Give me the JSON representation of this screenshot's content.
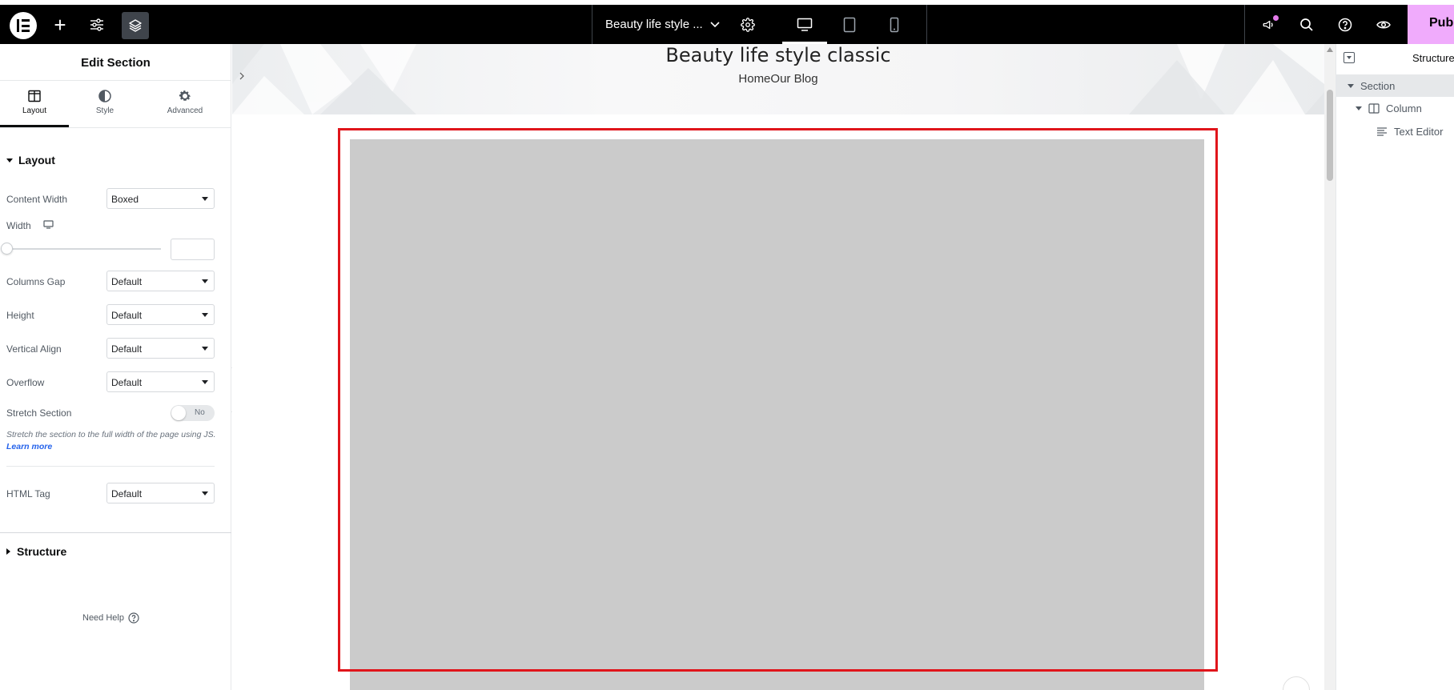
{
  "toolbar": {
    "document_title": "Beauty life style ...",
    "publish_label": "Publ"
  },
  "panel": {
    "title": "Edit Section",
    "tabs": [
      {
        "label": "Layout",
        "icon": "columns-icon"
      },
      {
        "label": "Style",
        "icon": "contrast-icon"
      },
      {
        "label": "Advanced",
        "icon": "gear-icon"
      }
    ],
    "layout_section": "Layout",
    "controls": {
      "content_width": {
        "label": "Content Width",
        "value": "Boxed"
      },
      "width": {
        "label": "Width",
        "value": ""
      },
      "columns_gap": {
        "label": "Columns Gap",
        "value": "Default"
      },
      "height": {
        "label": "Height",
        "value": "Default"
      },
      "vertical_align": {
        "label": "Vertical Align",
        "value": "Default"
      },
      "overflow": {
        "label": "Overflow",
        "value": "Default"
      },
      "stretch_section": {
        "label": "Stretch Section",
        "value": "No"
      },
      "html_tag": {
        "label": "HTML Tag",
        "value": "Default"
      }
    },
    "stretch_description": "Stretch the section to the full width of the page using JS.",
    "learn_more": "Learn more",
    "structure_section": "Structure",
    "need_help": "Need Help"
  },
  "canvas": {
    "hero_title": "Beauty life style classic",
    "breadcrumb": [
      "Home",
      "Our Blog"
    ]
  },
  "navigator": {
    "title": "Structure",
    "items": [
      {
        "label": "Section"
      },
      {
        "label": "Column"
      },
      {
        "label": "Text Editor"
      }
    ]
  },
  "colors": {
    "selection": "#e0151b",
    "publish": "#f0abfc",
    "topbar": "#000000"
  }
}
